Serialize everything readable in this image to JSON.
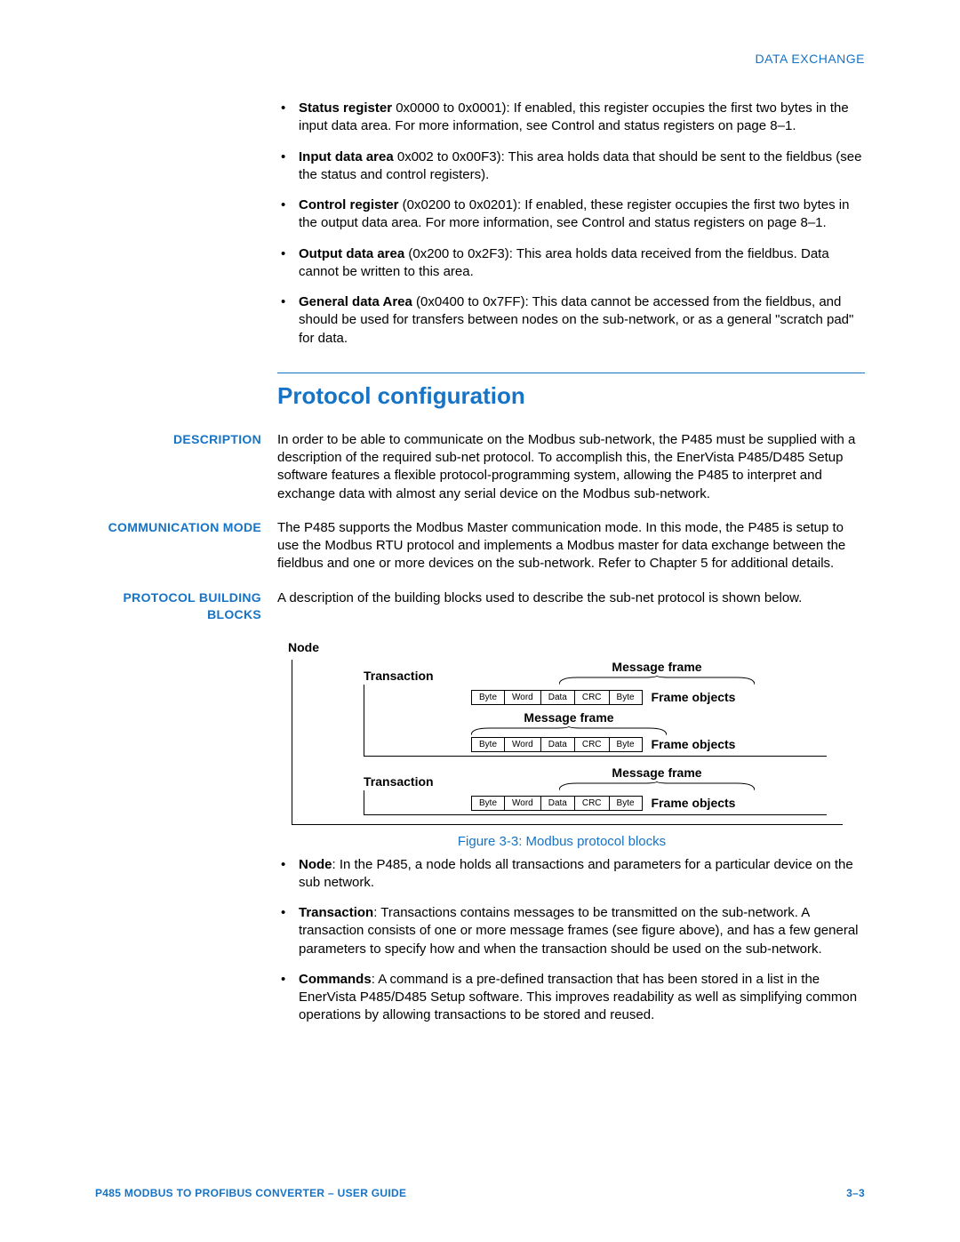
{
  "running_head": "DATA EXCHANGE",
  "top_bullets": [
    {
      "lead": "Status register",
      "rest": " 0x0000 to 0x0001): If enabled, this register occupies the first two bytes in the input data area. For more information, see Control and status registers on page 8–1."
    },
    {
      "lead": "Input data area",
      "rest": " 0x002 to 0x00F3): This area holds data that should be sent to the fieldbus (see the status and control registers)."
    },
    {
      "lead": "Control register",
      "rest": " (0x0200 to 0x0201): If enabled, these register occupies the first two bytes in the output data area. For more information, see Control and status registers on page 8–1."
    },
    {
      "lead": "Output data area",
      "rest": " (0x200 to 0x2F3): This area holds data received from the fieldbus. Data cannot be written to this area."
    },
    {
      "lead": "General data Area",
      "rest": " (0x0400 to 0x7FF): This data cannot be accessed from the fieldbus, and should be used for transfers between nodes on the sub-network, or as a general \"scratch pad\" for data."
    }
  ],
  "section_heading": "Protocol configuration",
  "rows": {
    "description": {
      "label": "DESCRIPTION",
      "text": "In order to be able to communicate on the Modbus sub-network, the P485 must be supplied with a description of the required sub-net protocol. To accomplish this, the EnerVista P485/D485 Setup software features a flexible protocol-programming system, allowing the P485 to interpret and exchange data with almost any serial device on the Modbus sub-network."
    },
    "comm_mode": {
      "label": "COMMUNICATION MODE",
      "text": "The P485 supports the Modbus Master communication mode. In this mode, the P485 is setup to use the Modbus RTU protocol and implements a Modbus master for data exchange between the fieldbus and one or more devices on the sub-network. Refer to Chapter 5 for additional details."
    },
    "protocol_blocks": {
      "label": "PROTOCOL BUILDING BLOCKS",
      "text": "A description of the building blocks used to describe the sub-net protocol is shown below."
    }
  },
  "diagram": {
    "node_label": "Node",
    "transaction_label": "Transaction",
    "message_frame_label": "Message frame",
    "frame_objects_label": "Frame objects",
    "cells": [
      "Byte",
      "Word",
      "Data",
      "CRC",
      "Byte"
    ]
  },
  "figure_caption": "Figure 3-3: Modbus protocol blocks",
  "definition_bullets": [
    {
      "lead": "Node",
      "rest": ": In the P485, a node holds all transactions and parameters for a particular device on the sub network."
    },
    {
      "lead": "Transaction",
      "rest": ": Transactions contains messages to be transmitted on the sub-network. A transaction consists of one or more message frames (see figure above), and has a few general parameters to specify how and when the transaction should be used on the sub-network."
    },
    {
      "lead": "Commands",
      "rest": ": A command is a pre-defined transaction that has been stored in a list in the EnerVista P485/D485 Setup software. This improves readability as well as simplifying common operations by allowing transactions to be stored and reused."
    }
  ],
  "footer": {
    "left": "P485 MODBUS TO PROFIBUS CONVERTER – USER GUIDE",
    "right": "3–3"
  }
}
